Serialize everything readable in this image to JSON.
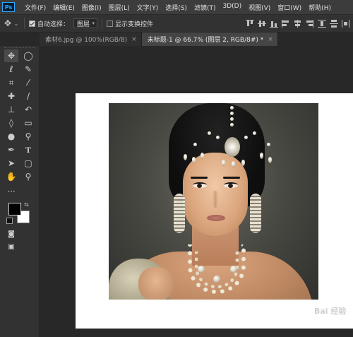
{
  "app": {
    "logo": "Ps"
  },
  "menubar": {
    "items": [
      "文件(F)",
      "编辑(E)",
      "图像(I)",
      "图层(L)",
      "文字(Y)",
      "选择(S)",
      "滤镜(T)",
      "3D(D)",
      "视图(V)",
      "窗口(W)",
      "帮助(H)"
    ]
  },
  "options": {
    "auto_select_label": "自动选择：",
    "auto_select_checked": true,
    "target_value": "图层",
    "show_transform_label": "显示变换控件",
    "show_transform_checked": false
  },
  "tabs": [
    {
      "label": "素材6.jpg @ 100%(RGB/8)",
      "active": false,
      "close": "×"
    },
    {
      "label": "未标题-1 @ 66.7% (图层 2, RGB/8#) *",
      "active": true,
      "close": "×"
    }
  ],
  "colors": {
    "foreground": "#000000",
    "background": "#ffffff",
    "ui_dark": "#282828",
    "ui_panel": "#323232",
    "accent": "#31a8ff"
  },
  "toolbar_icons": [
    "move-tool-icon",
    "marquee-tool-icon",
    "lasso-tool-icon",
    "quick-select-tool-icon",
    "crop-tool-icon",
    "eyedropper-tool-icon",
    "healing-brush-tool-icon",
    "brush-tool-icon",
    "clone-stamp-tool-icon",
    "history-brush-tool-icon",
    "eraser-tool-icon",
    "gradient-tool-icon",
    "blur-tool-icon",
    "dodge-tool-icon",
    "pen-tool-icon",
    "type-tool-icon",
    "path-select-tool-icon",
    "shape-tool-icon",
    "hand-tool-icon",
    "zoom-tool-icon",
    "more-tools-icon"
  ],
  "watermark": "Bai 经验"
}
